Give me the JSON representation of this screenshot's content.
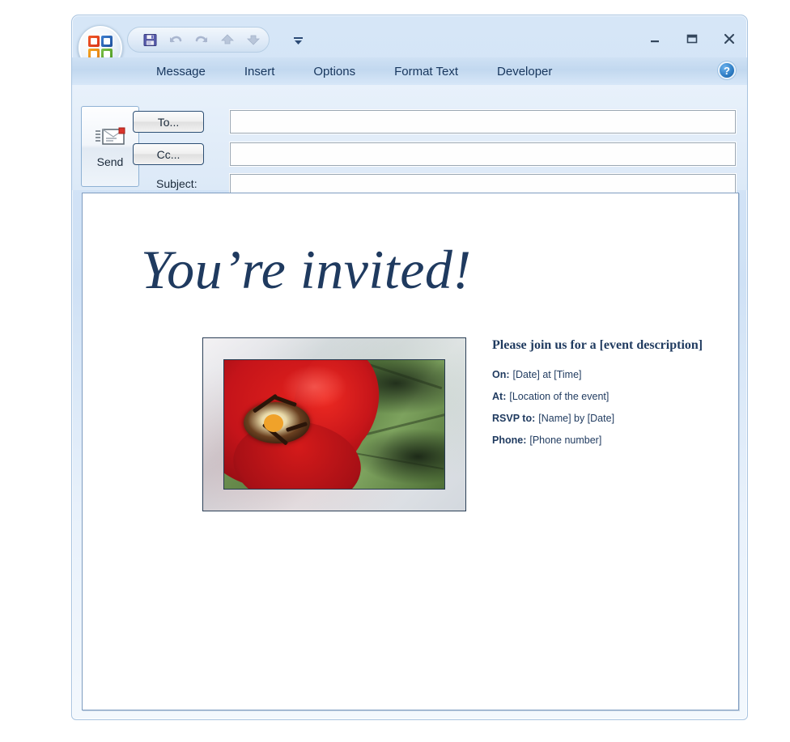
{
  "window": {
    "app_logo": "office-orb-icon",
    "controls": [
      {
        "name": "minimize",
        "glyph": "–"
      },
      {
        "name": "restore",
        "glyph": "❐"
      },
      {
        "name": "close",
        "glyph": "✕"
      }
    ]
  },
  "quick_access_toolbar": {
    "buttons": [
      {
        "name": "save-icon",
        "label": "Save"
      },
      {
        "name": "undo-icon",
        "label": "Undo"
      },
      {
        "name": "redo-icon",
        "label": "Redo"
      },
      {
        "name": "previous-item-icon",
        "label": "Previous Item"
      },
      {
        "name": "next-item-icon",
        "label": "Next Item"
      }
    ],
    "customize_glyph": "▼"
  },
  "ribbon": {
    "tabs": [
      {
        "label": "Message"
      },
      {
        "label": "Insert"
      },
      {
        "label": "Options"
      },
      {
        "label": "Format Text"
      },
      {
        "label": "Developer"
      }
    ],
    "help_glyph": "?"
  },
  "compose": {
    "send_label": "Send",
    "to_label": "To...",
    "cc_label": "Cc...",
    "subject_label": "Subject:",
    "to_value": "",
    "cc_value": "",
    "subject_value": "",
    "to_placeholder": "",
    "cc_placeholder": "",
    "subject_placeholder": ""
  },
  "message": {
    "heading": "You’re invited!",
    "subheading": "Please join us for a [event description]",
    "photo_alt": "red tulip flower photo in beveled frame",
    "details": [
      {
        "label": "On:",
        "value": "[Date] at [Time]"
      },
      {
        "label": "At:",
        "value": "[Location of the event]"
      },
      {
        "label": "RSVP to:",
        "value": "[Name] by [Date]"
      },
      {
        "label": "Phone:",
        "value": "[Phone number]"
      }
    ]
  },
  "colors": {
    "heading_navy": "#1F3A5F",
    "ribbon_blue": "#C2D8EF",
    "window_chrome": "#D6E6F7",
    "field_border": "#9AA7B3",
    "button_border": "#2D4F74"
  }
}
